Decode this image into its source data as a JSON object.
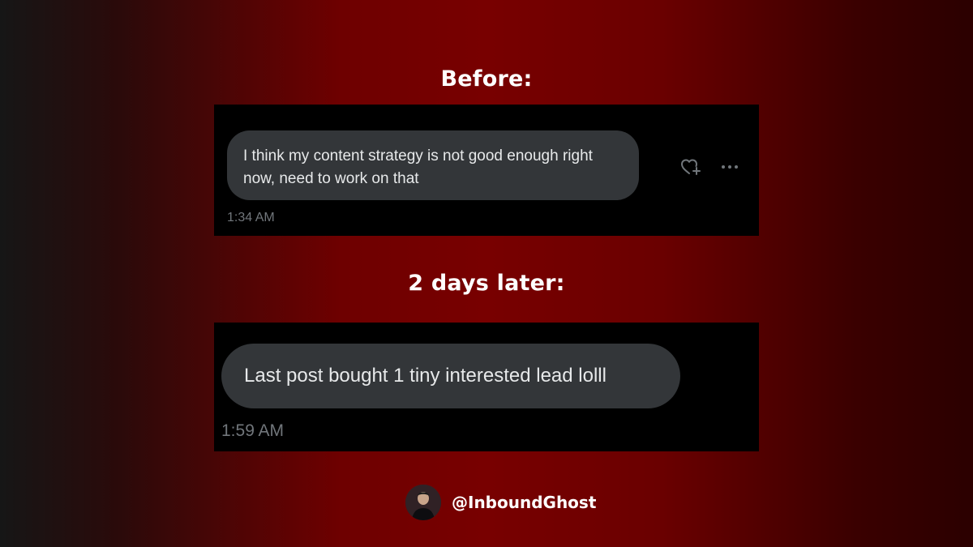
{
  "before_section": {
    "heading": "Before:",
    "message": "I think my content strategy is not good enough right now, need to work on that",
    "timestamp": "1:34 AM",
    "react_icon": "heart-plus-icon",
    "more_icon": "more-horizontal-icon"
  },
  "after_section": {
    "heading": "2 days later:",
    "message": "Last post bought 1 tiny interested lead lolll",
    "timestamp": "1:59 AM"
  },
  "footer": {
    "handle": "@InboundGhost"
  },
  "colors": {
    "bubble": "#333639",
    "timestamp": "#71767b",
    "background_accent": "#780000"
  }
}
